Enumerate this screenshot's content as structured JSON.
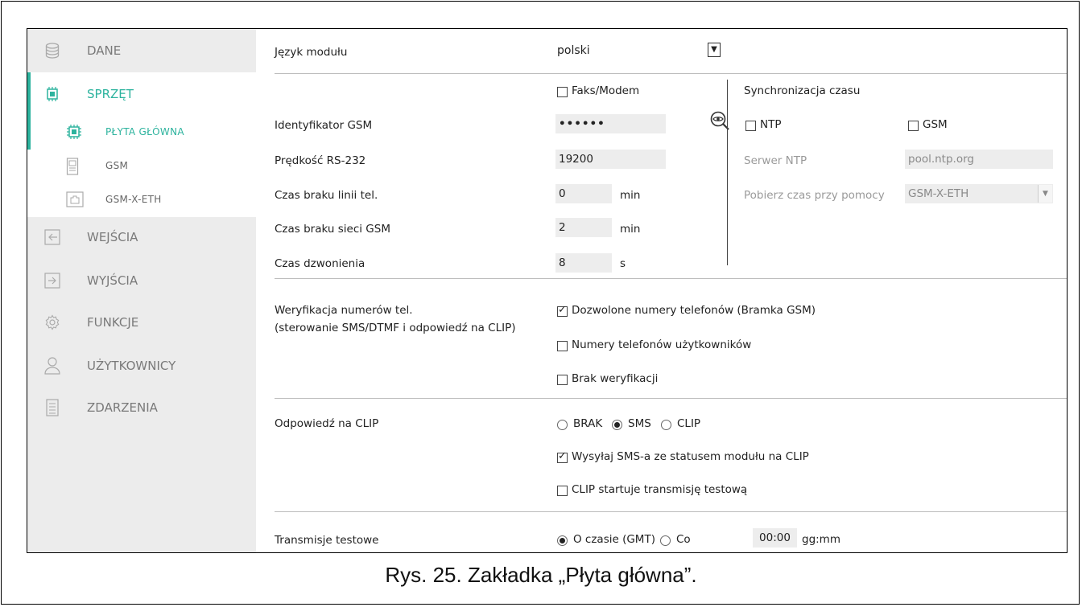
{
  "colors": {
    "accent": "#2db39e",
    "sidebar_bg": "#ececec",
    "field_bg": "#ededed"
  },
  "sidebar": {
    "items": [
      {
        "label": "DANE",
        "icon": "database-icon"
      },
      {
        "label": "SPRZĘT",
        "icon": "chip-icon"
      },
      {
        "label": "WEJŚCIA",
        "icon": "input-icon"
      },
      {
        "label": "WYJŚCIA",
        "icon": "output-icon"
      },
      {
        "label": "FUNKCJE",
        "icon": "gear-icon"
      },
      {
        "label": "UŻYTKOWNICY",
        "icon": "user-icon"
      },
      {
        "label": "ZDARZENIA",
        "icon": "document-icon"
      }
    ],
    "subitems": [
      {
        "label": "PŁYTA GŁÓWNA",
        "icon": "chip-icon"
      },
      {
        "label": "GSM",
        "icon": "gsm-module-icon"
      },
      {
        "label": "GSM-X-ETH",
        "icon": "ethernet-module-icon"
      }
    ]
  },
  "form": {
    "language": {
      "label": "Język modułu",
      "value": "polski"
    },
    "fax_modem": "Faks/Modem",
    "gsm_id": {
      "label": "Identyfikator GSM",
      "value": "••••••"
    },
    "rs232": {
      "label": "Prędkość RS-232",
      "value": "19200"
    },
    "no_line": {
      "label": "Czas braku linii tel.",
      "value": "0",
      "unit": "min"
    },
    "no_gsm": {
      "label": "Czas braku sieci GSM",
      "value": "2",
      "unit": "min"
    },
    "ring": {
      "label": "Czas dzwonienia",
      "value": "8",
      "unit": "s"
    },
    "sync": {
      "title": "Synchronizacja czasu",
      "ntp": "NTP",
      "gsm": "GSM",
      "server_label": "Serwer NTP",
      "server_value": "pool.ntp.org",
      "get_label": "Pobierz czas przy pomocy",
      "get_value": "GSM-X-ETH"
    },
    "verification": {
      "label1": "Weryfikacja numerów tel.",
      "label2": "(sterowanie SMS/DTMF i odpowiedź na CLIP)",
      "opt1": "Dozwolone numery telefonów (Bramka GSM)",
      "opt2": "Numery telefonów użytkowników",
      "opt3": "Brak weryfikacji"
    },
    "clip": {
      "label": "Odpowiedź na CLIP",
      "r1": "BRAK",
      "r2": "SMS",
      "r3": "CLIP",
      "opt1": "Wysyłaj SMS-a ze statusem modułu na CLIP",
      "opt2": "CLIP startuje transmisję testową"
    },
    "test": {
      "label": "Transmisje testowe",
      "r1": "O czasie (GMT)",
      "r2": "Co",
      "time": "00:00",
      "unit": "gg:mm"
    }
  },
  "caption": "Rys. 25. Zakładka „Płyta główna”."
}
